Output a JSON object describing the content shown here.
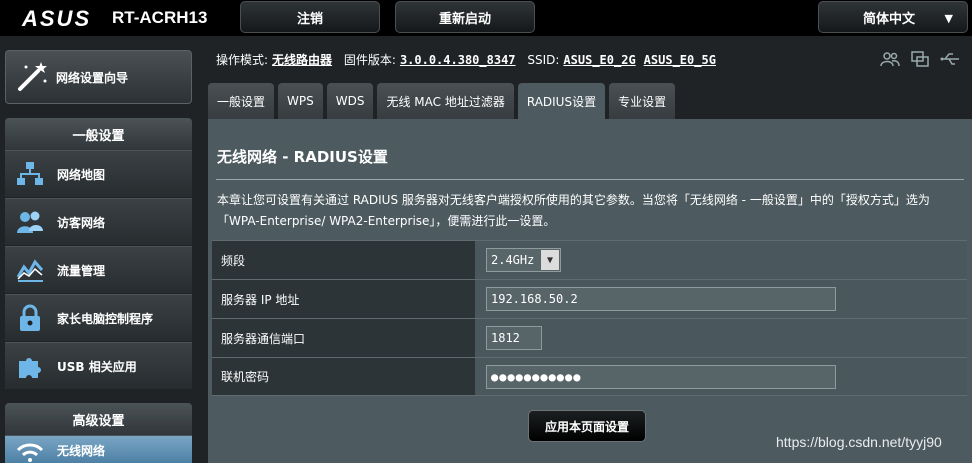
{
  "header": {
    "brand": "ASUS",
    "model": "RT-ACRH13",
    "logout_label": "注销",
    "reboot_label": "重新启动",
    "language_label": "简体中文"
  },
  "sidebar": {
    "wizard_label": "网络设置向导",
    "general_heading": "一般设置",
    "general_items": [
      {
        "label": "网络地图"
      },
      {
        "label": "访客网络"
      },
      {
        "label": "流量管理"
      },
      {
        "label": "家长电脑控制程序"
      },
      {
        "label": "USB 相关应用"
      }
    ],
    "advanced_heading": "高级设置",
    "advanced_items": [
      {
        "label": "无线网络"
      }
    ]
  },
  "info": {
    "mode_label": "操作模式:",
    "mode_value": "无线路由器",
    "firmware_label": "固件版本:",
    "firmware_value": "3.0.0.4.380_8347",
    "ssid_label": "SSID:",
    "ssid_2g": "ASUS_E0_2G",
    "ssid_5g": "ASUS_E0_5G"
  },
  "tabs": [
    {
      "label": "一般设置"
    },
    {
      "label": "WPS"
    },
    {
      "label": "WDS"
    },
    {
      "label": "无线 MAC 地址过滤器"
    },
    {
      "label": "RADIUS设置"
    },
    {
      "label": "专业设置"
    }
  ],
  "main": {
    "title": "无线网络 - RADIUS设置",
    "description": "本章让您可设置有关通过 RADIUS 服务器对无线客户端授权所使用的其它参数。当您将「无线网络 - 一般设置」中的「授权方式」选为「WPA-Enterprise/ WPA2-Enterprise」，便需进行此一设置。",
    "fields": {
      "band_label": "频段",
      "band_value": "2.4GHz",
      "ip_label": "服务器 IP 地址",
      "ip_value": "192.168.50.2",
      "port_label": "服务器通信端口",
      "port_value": "1812",
      "secret_label": "联机密码",
      "secret_value": "●●●●●●●●●●●"
    },
    "apply_label": "应用本页面设置"
  },
  "watermark": "https://blog.csdn.net/tyyj90",
  "colors": {
    "accent_active": "#6f9ab9",
    "panel_bg": "#4d5b60",
    "page_bg": "#1f2326"
  }
}
